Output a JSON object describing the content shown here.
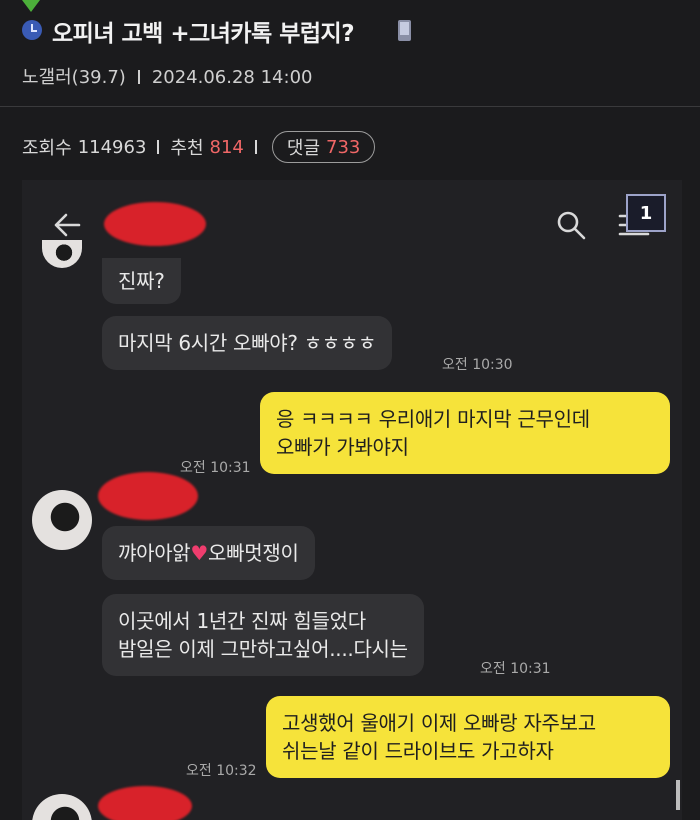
{
  "post": {
    "title": "오피녀 고백 +그녀카톡 부럽지?",
    "author": "노갤러(39.7)",
    "datetime": "2024.06.28 14:00",
    "views_label": "조회수",
    "views": "114963",
    "recommend_label": "추천",
    "recommend": "814",
    "comments_label": "댓글",
    "comments": "733",
    "colors": {
      "accent_red": "#f06767",
      "background": "#1b1b1d"
    }
  },
  "chat": {
    "page_badge": "1",
    "messages": [
      {
        "side": "in",
        "text": "진짜?"
      },
      {
        "side": "in",
        "text": "마지막 6시간 오빠야? ㅎㅎㅎㅎ",
        "time": "오전 10:30"
      },
      {
        "side": "out",
        "lines": [
          "응 ㅋㅋㅋㅋ  우리애기 마지막 근무인데",
          "오빠가 가봐야지"
        ],
        "time": "오전 10:31"
      },
      {
        "side": "in",
        "text_before": "꺄아아앍",
        "text_after": " 오빠멋쟁이"
      },
      {
        "side": "in",
        "lines": [
          "이곳에서 1년간 진짜 힘들었다",
          "밤일은 이제 그만하고싶어....다시는"
        ],
        "time": "오전 10:31"
      },
      {
        "side": "out",
        "lines": [
          "고생했어 울애기 이제 오빠랑 자주보고",
          "쉬는날 같이 드라이브도 가고하자"
        ],
        "time": "오전 10:32"
      }
    ],
    "colors": {
      "incoming": "#323235",
      "outgoing": "#f6e33a",
      "redaction": "#d8222a"
    }
  }
}
